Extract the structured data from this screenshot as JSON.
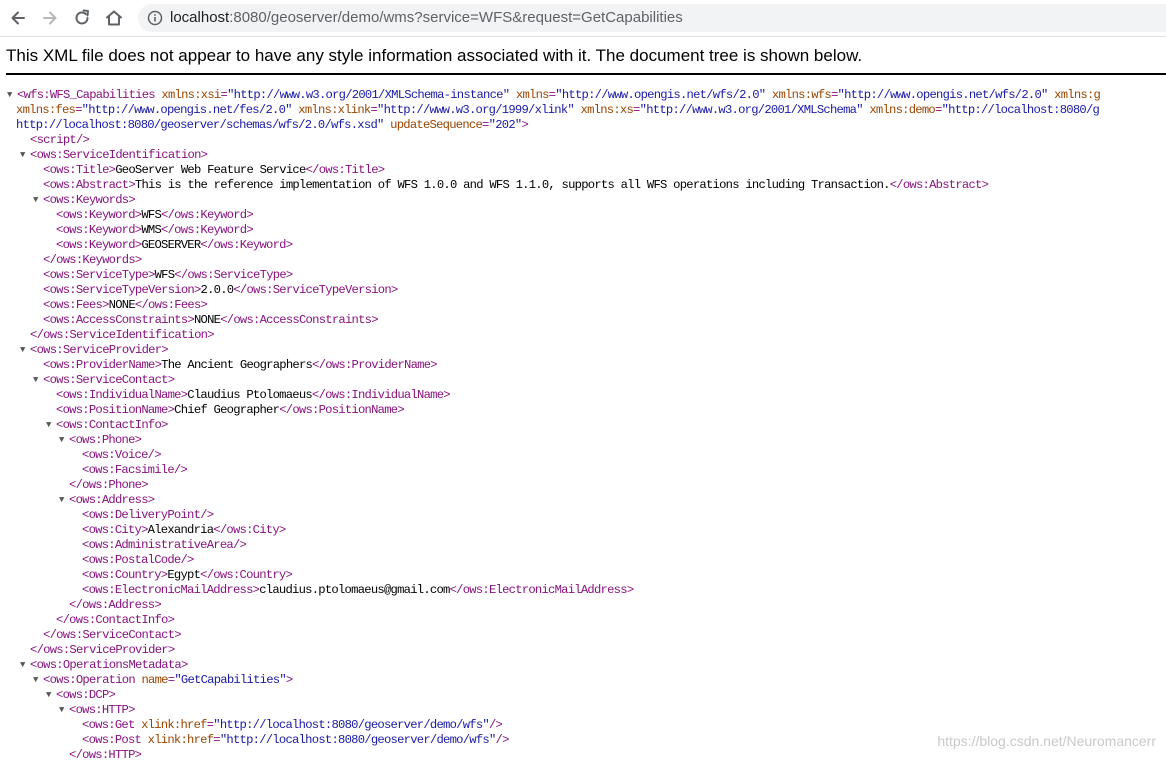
{
  "browser": {
    "url_host": "localhost",
    "url_rest": ":8080/geoserver/demo/wms?service=WFS&request=GetCapabilities",
    "icons": [
      "back-arrow-icon",
      "forward-arrow-icon",
      "reload-icon",
      "home-icon",
      "info-icon"
    ]
  },
  "notice": "This XML file does not appear to have any style information associated with it. The document tree is shown below.",
  "watermark": "https://blog.csdn.net/Neuromancerr",
  "lines": [
    {
      "i": 0,
      "t": 1,
      "s": [
        [
          "t",
          "<wfs:WFS_Capabilities "
        ],
        [
          "a",
          "xmlns:xsi"
        ],
        [
          "t",
          "="
        ],
        [
          "v",
          "\"http://www.w3.org/2001/XMLSchema-instance\""
        ],
        [
          "a",
          " xmlns"
        ],
        [
          "t",
          "="
        ],
        [
          "v",
          "\"http://www.opengis.net/wfs/2.0\""
        ],
        [
          "a",
          " xmlns:wfs"
        ],
        [
          "t",
          "="
        ],
        [
          "v",
          "\"http://www.opengis.net/wfs/2.0\""
        ],
        [
          "a",
          " xmlns:g"
        ]
      ]
    },
    {
      "i": 0,
      "t": 0,
      "x": 16,
      "s": [
        [
          "a",
          "xmlns:fes"
        ],
        [
          "t",
          "="
        ],
        [
          "v",
          "\"http://www.opengis.net/fes/2.0\""
        ],
        [
          "a",
          " xmlns:xlink"
        ],
        [
          "t",
          "="
        ],
        [
          "v",
          "\"http://www.w3.org/1999/xlink\""
        ],
        [
          "a",
          " xmlns:xs"
        ],
        [
          "t",
          "="
        ],
        [
          "v",
          "\"http://www.w3.org/2001/XMLSchema\""
        ],
        [
          "a",
          " xmlns:demo"
        ],
        [
          "t",
          "="
        ],
        [
          "v",
          "\"http://localhost:8080/g"
        ]
      ]
    },
    {
      "i": 0,
      "t": 0,
      "x": 16,
      "s": [
        [
          "v",
          "http://localhost:8080/geoserver/schemas/wfs/2.0/wfs.xsd\""
        ],
        [
          "a",
          " updateSequence"
        ],
        [
          "t",
          "="
        ],
        [
          "v",
          "\"202\""
        ],
        [
          "t",
          ">"
        ]
      ]
    },
    {
      "i": 1,
      "t": 0,
      "s": [
        [
          "t",
          "<script/>"
        ]
      ]
    },
    {
      "i": 1,
      "t": 1,
      "s": [
        [
          "t",
          "<ows:ServiceIdentification>"
        ]
      ]
    },
    {
      "i": 2,
      "t": 0,
      "s": [
        [
          "t",
          "<ows:Title>"
        ],
        [
          "x",
          "GeoServer Web Feature Service"
        ],
        [
          "t",
          "</ows:Title>"
        ]
      ]
    },
    {
      "i": 2,
      "t": 0,
      "s": [
        [
          "t",
          "<ows:Abstract>"
        ],
        [
          "x",
          "This is the reference implementation of WFS 1.0.0 and WFS 1.1.0, supports all WFS operations including Transaction."
        ],
        [
          "t",
          "</ows:Abstract>"
        ]
      ]
    },
    {
      "i": 2,
      "t": 1,
      "s": [
        [
          "t",
          "<ows:Keywords>"
        ]
      ]
    },
    {
      "i": 3,
      "t": 0,
      "s": [
        [
          "t",
          "<ows:Keyword>"
        ],
        [
          "x",
          "WFS"
        ],
        [
          "t",
          "</ows:Keyword>"
        ]
      ]
    },
    {
      "i": 3,
      "t": 0,
      "s": [
        [
          "t",
          "<ows:Keyword>"
        ],
        [
          "x",
          "WMS"
        ],
        [
          "t",
          "</ows:Keyword>"
        ]
      ]
    },
    {
      "i": 3,
      "t": 0,
      "s": [
        [
          "t",
          "<ows:Keyword>"
        ],
        [
          "x",
          "GEOSERVER"
        ],
        [
          "t",
          "</ows:Keyword>"
        ]
      ]
    },
    {
      "i": 2,
      "t": 0,
      "s": [
        [
          "t",
          "</ows:Keywords>"
        ]
      ]
    },
    {
      "i": 2,
      "t": 0,
      "s": [
        [
          "t",
          "<ows:ServiceType>"
        ],
        [
          "x",
          "WFS"
        ],
        [
          "t",
          "</ows:ServiceType>"
        ]
      ]
    },
    {
      "i": 2,
      "t": 0,
      "s": [
        [
          "t",
          "<ows:ServiceTypeVersion>"
        ],
        [
          "x",
          "2.0.0"
        ],
        [
          "t",
          "</ows:ServiceTypeVersion>"
        ]
      ]
    },
    {
      "i": 2,
      "t": 0,
      "s": [
        [
          "t",
          "<ows:Fees>"
        ],
        [
          "x",
          "NONE"
        ],
        [
          "t",
          "</ows:Fees>"
        ]
      ]
    },
    {
      "i": 2,
      "t": 0,
      "s": [
        [
          "t",
          "<ows:AccessConstraints>"
        ],
        [
          "x",
          "NONE"
        ],
        [
          "t",
          "</ows:AccessConstraints>"
        ]
      ]
    },
    {
      "i": 1,
      "t": 0,
      "s": [
        [
          "t",
          "</ows:ServiceIdentification>"
        ]
      ]
    },
    {
      "i": 1,
      "t": 1,
      "s": [
        [
          "t",
          "<ows:ServiceProvider>"
        ]
      ]
    },
    {
      "i": 2,
      "t": 0,
      "s": [
        [
          "t",
          "<ows:ProviderName>"
        ],
        [
          "x",
          "The Ancient Geographers"
        ],
        [
          "t",
          "</ows:ProviderName>"
        ]
      ]
    },
    {
      "i": 2,
      "t": 1,
      "s": [
        [
          "t",
          "<ows:ServiceContact>"
        ]
      ]
    },
    {
      "i": 3,
      "t": 0,
      "s": [
        [
          "t",
          "<ows:IndividualName>"
        ],
        [
          "x",
          "Claudius Ptolomaeus"
        ],
        [
          "t",
          "</ows:IndividualName>"
        ]
      ]
    },
    {
      "i": 3,
      "t": 0,
      "s": [
        [
          "t",
          "<ows:PositionName>"
        ],
        [
          "x",
          "Chief Geographer"
        ],
        [
          "t",
          "</ows:PositionName>"
        ]
      ]
    },
    {
      "i": 3,
      "t": 1,
      "s": [
        [
          "t",
          "<ows:ContactInfo>"
        ]
      ]
    },
    {
      "i": 4,
      "t": 1,
      "s": [
        [
          "t",
          "<ows:Phone>"
        ]
      ]
    },
    {
      "i": 5,
      "t": 0,
      "s": [
        [
          "t",
          "<ows:Voice/>"
        ]
      ]
    },
    {
      "i": 5,
      "t": 0,
      "s": [
        [
          "t",
          "<ows:Facsimile/>"
        ]
      ]
    },
    {
      "i": 4,
      "t": 0,
      "s": [
        [
          "t",
          "</ows:Phone>"
        ]
      ]
    },
    {
      "i": 4,
      "t": 1,
      "s": [
        [
          "t",
          "<ows:Address>"
        ]
      ]
    },
    {
      "i": 5,
      "t": 0,
      "s": [
        [
          "t",
          "<ows:DeliveryPoint/>"
        ]
      ]
    },
    {
      "i": 5,
      "t": 0,
      "s": [
        [
          "t",
          "<ows:City>"
        ],
        [
          "x",
          "Alexandria"
        ],
        [
          "t",
          "</ows:City>"
        ]
      ]
    },
    {
      "i": 5,
      "t": 0,
      "s": [
        [
          "t",
          "<ows:AdministrativeArea/>"
        ]
      ]
    },
    {
      "i": 5,
      "t": 0,
      "s": [
        [
          "t",
          "<ows:PostalCode/>"
        ]
      ]
    },
    {
      "i": 5,
      "t": 0,
      "s": [
        [
          "t",
          "<ows:Country>"
        ],
        [
          "x",
          "Egypt"
        ],
        [
          "t",
          "</ows:Country>"
        ]
      ]
    },
    {
      "i": 5,
      "t": 0,
      "s": [
        [
          "t",
          "<ows:ElectronicMailAddress>"
        ],
        [
          "x",
          "claudius.ptolomaeus@gmail.com"
        ],
        [
          "t",
          "</ows:ElectronicMailAddress>"
        ]
      ]
    },
    {
      "i": 4,
      "t": 0,
      "s": [
        [
          "t",
          "</ows:Address>"
        ]
      ]
    },
    {
      "i": 3,
      "t": 0,
      "s": [
        [
          "t",
          "</ows:ContactInfo>"
        ]
      ]
    },
    {
      "i": 2,
      "t": 0,
      "s": [
        [
          "t",
          "</ows:ServiceContact>"
        ]
      ]
    },
    {
      "i": 1,
      "t": 0,
      "s": [
        [
          "t",
          "</ows:ServiceProvider>"
        ]
      ]
    },
    {
      "i": 1,
      "t": 1,
      "s": [
        [
          "t",
          "<ows:OperationsMetadata>"
        ]
      ]
    },
    {
      "i": 2,
      "t": 1,
      "s": [
        [
          "t",
          "<ows:Operation "
        ],
        [
          "a",
          "name"
        ],
        [
          "t",
          "="
        ],
        [
          "v",
          "\"GetCapabilities\""
        ],
        [
          "t",
          ">"
        ]
      ]
    },
    {
      "i": 3,
      "t": 1,
      "s": [
        [
          "t",
          "<ows:DCP>"
        ]
      ]
    },
    {
      "i": 4,
      "t": 1,
      "s": [
        [
          "t",
          "<ows:HTTP>"
        ]
      ]
    },
    {
      "i": 5,
      "t": 0,
      "s": [
        [
          "t",
          "<ows:Get "
        ],
        [
          "a",
          "xlink:href"
        ],
        [
          "t",
          "="
        ],
        [
          "v",
          "\"http://localhost:8080/geoserver/demo/wfs\""
        ],
        [
          "t",
          "/>"
        ]
      ]
    },
    {
      "i": 5,
      "t": 0,
      "s": [
        [
          "t",
          "<ows:Post "
        ],
        [
          "a",
          "xlink:href"
        ],
        [
          "t",
          "="
        ],
        [
          "v",
          "\"http://localhost:8080/geoserver/demo/wfs\""
        ],
        [
          "t",
          "/>"
        ]
      ]
    },
    {
      "i": 4,
      "t": 0,
      "s": [
        [
          "t",
          "</ows:HTTP>"
        ]
      ]
    }
  ]
}
